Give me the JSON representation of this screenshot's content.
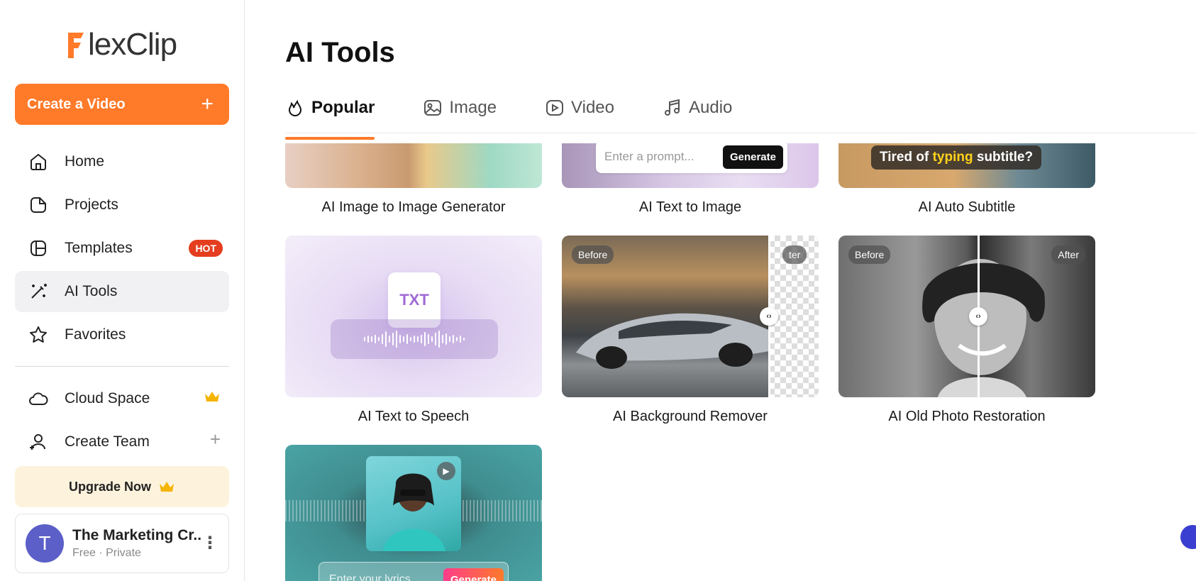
{
  "brand": {
    "logo_text": "lexClip",
    "logo_letter": "F",
    "accent": "#ff7a29"
  },
  "sidebar": {
    "create_label": "Create a Video",
    "items": [
      {
        "label": "Home",
        "icon": "home-icon"
      },
      {
        "label": "Projects",
        "icon": "projects-icon"
      },
      {
        "label": "Templates",
        "icon": "templates-icon",
        "badge": "HOT"
      },
      {
        "label": "AI Tools",
        "icon": "magic-wand-icon",
        "active": true
      },
      {
        "label": "Favorites",
        "icon": "star-icon"
      }
    ],
    "items2": [
      {
        "label": "Cloud Space",
        "icon": "cloud-icon"
      },
      {
        "label": "Create Team",
        "icon": "add-user-icon"
      }
    ],
    "upgrade_label": "Upgrade Now",
    "account": {
      "initial": "T",
      "name": "The Marketing Cr...",
      "sub": "Free · Private"
    }
  },
  "main": {
    "title": "AI Tools",
    "tabs": [
      {
        "label": "Popular",
        "active": true
      },
      {
        "label": "Image"
      },
      {
        "label": "Video"
      },
      {
        "label": "Audio"
      }
    ],
    "cards": [
      {
        "label": "AI Image to Image Generator"
      },
      {
        "label": "AI Text to Image",
        "prompt_placeholder": "Enter a prompt...",
        "generate": "Generate"
      },
      {
        "label": "AI Auto Subtitle",
        "caption_pre": "Tired of ",
        "caption_hl": "typing",
        "caption_post": " subtitle?"
      },
      {
        "label": "AI Text to Speech",
        "doc": "TXT"
      },
      {
        "label": "AI Background Remover",
        "before": "Before",
        "after": "ter"
      },
      {
        "label": "AI Old Photo Restoration",
        "before": "Before",
        "after": "After"
      },
      {
        "label": "",
        "lyrics_placeholder": "Enter your lyrics...",
        "generate": "Generate"
      }
    ]
  }
}
